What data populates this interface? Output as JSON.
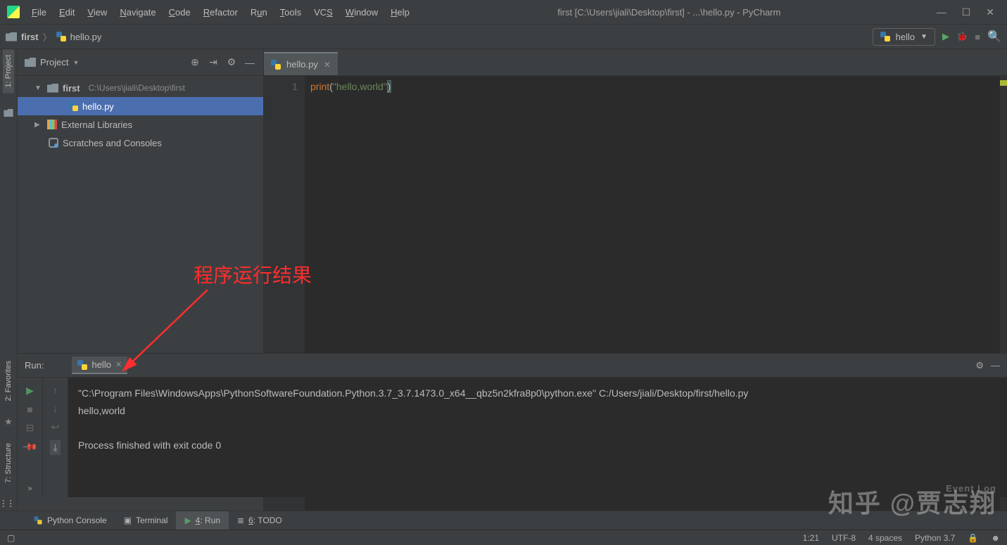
{
  "menu": [
    "File",
    "Edit",
    "View",
    "Navigate",
    "Code",
    "Refactor",
    "Run",
    "Tools",
    "VCS",
    "Window",
    "Help"
  ],
  "window_title": "first [C:\\Users\\jiali\\Desktop\\first] - ...\\hello.py - PyCharm",
  "breadcrumb": {
    "project": "first",
    "file": "hello.py"
  },
  "run_config": "hello",
  "project_panel": {
    "title": "Project",
    "root": {
      "name": "first",
      "path": "C:\\Users\\jiali\\Desktop\\first"
    },
    "file": "hello.py",
    "external": "External Libraries",
    "scratches": "Scratches and Consoles"
  },
  "left_tabs": {
    "project": "1: Project",
    "favorites": "2: Favorites",
    "structure": "7: Structure"
  },
  "editor": {
    "tab": "hello.py",
    "line_no": "1",
    "code": {
      "kw": "print",
      "open": "(",
      "str": "\"hello,world\"",
      "close": ")"
    }
  },
  "annotation": "程序运行结果",
  "run": {
    "label": "Run:",
    "tab": "hello",
    "line1": "\"C:\\Program Files\\WindowsApps\\PythonSoftwareFoundation.Python.3.7_3.7.1473.0_x64__qbz5n2kfra8p0\\python.exe\" C:/Users/jiali/Desktop/first/hello.py",
    "line2": "hello,world",
    "line3": "Process finished with exit code 0"
  },
  "bottom_tabs": {
    "console": "Python Console",
    "terminal": "Terminal",
    "run": "4: Run",
    "todo": "6: TODO",
    "eventlog": "Event Log"
  },
  "status": {
    "pos": "1:21",
    "enc": "UTF-8",
    "indent": "4 spaces",
    "py": "Python 3.7"
  },
  "watermark": {
    "main": "知乎 @贾志翔",
    "sub": "Event Log"
  }
}
